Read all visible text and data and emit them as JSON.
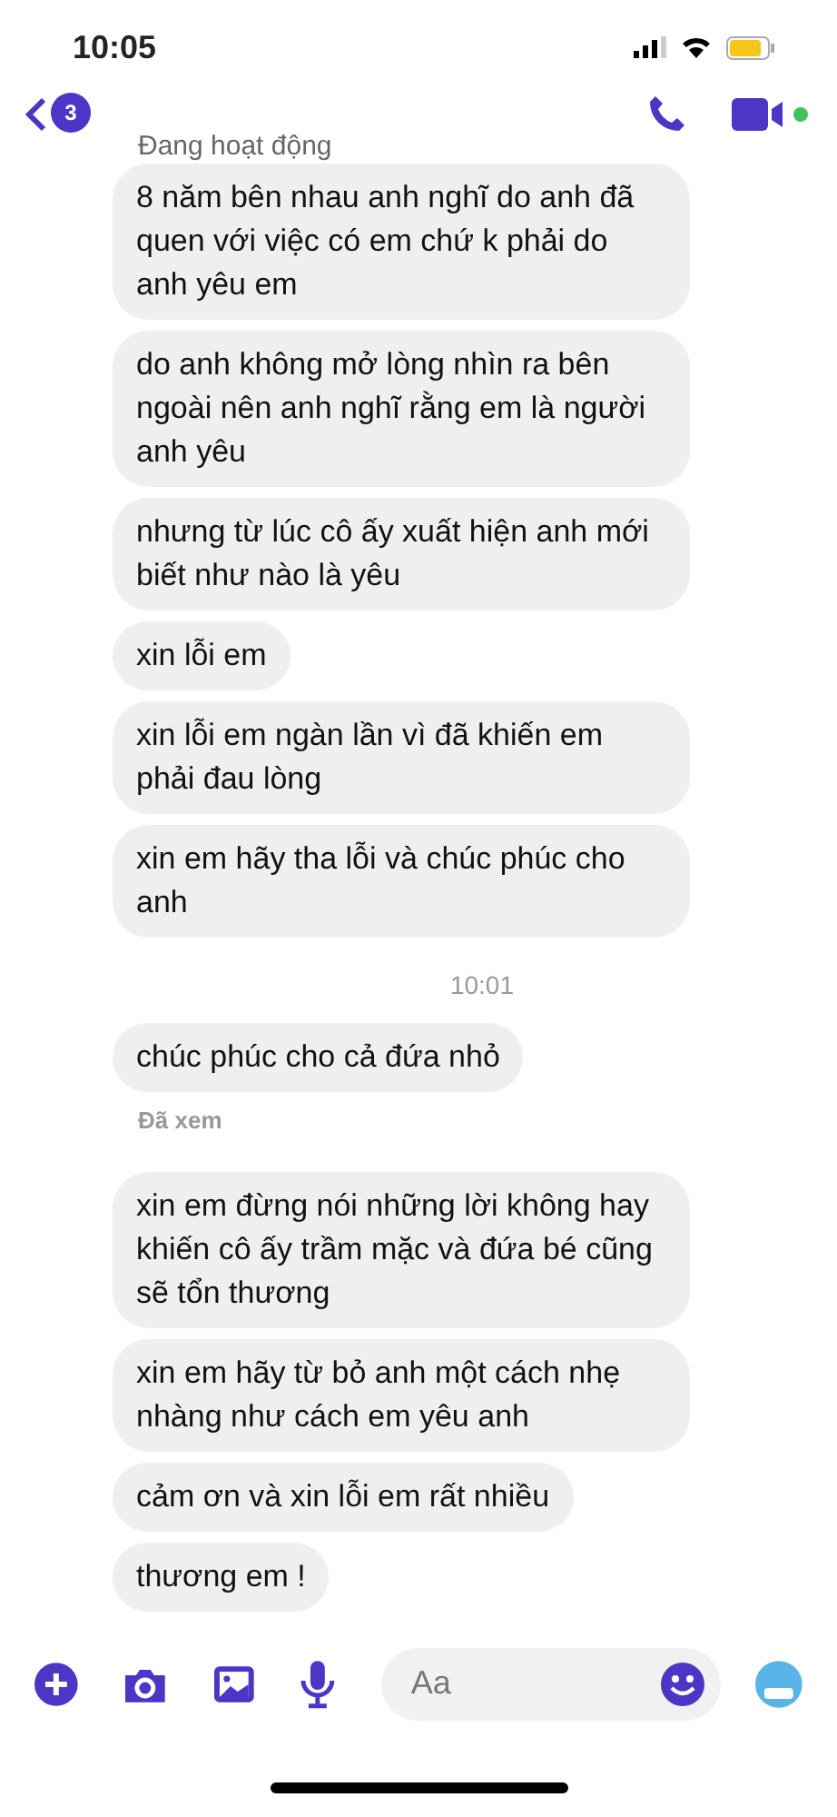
{
  "status_bar": {
    "time": "10:05"
  },
  "header": {
    "back_badge": "3",
    "status": "Đang hoạt động"
  },
  "messages": [
    {
      "kind": "bubble",
      "text": "8 năm bên nhau anh nghĩ do anh đã quen với việc có em chứ k phải do anh yêu em"
    },
    {
      "kind": "bubble",
      "text": "do anh không mở lòng nhìn ra bên ngoài nên anh nghĩ rằng em là người anh yêu"
    },
    {
      "kind": "bubble",
      "text": "nhưng từ lúc cô ấy xuất hiện anh mới biết như nào là yêu"
    },
    {
      "kind": "bubble",
      "text": "xin lỗi em"
    },
    {
      "kind": "bubble",
      "text": "xin lỗi em ngàn lần vì đã khiến em phải đau lòng"
    },
    {
      "kind": "bubble",
      "text": "xin em hãy tha lỗi và chúc phúc cho anh"
    },
    {
      "kind": "time",
      "text": "10:01"
    },
    {
      "kind": "bubble",
      "text": "chúc phúc cho cả đứa nhỏ"
    },
    {
      "kind": "seen",
      "text": "Đã xem"
    },
    {
      "kind": "bubble",
      "text": "xin em đừng nói những lời không hay khiến cô ấy trầm mặc và đứa bé cũng sẽ tổn thương"
    },
    {
      "kind": "bubble",
      "text": "xin em hãy từ bỏ anh một cách nhẹ nhàng như cách em yêu anh"
    },
    {
      "kind": "bubble",
      "text": "cảm ơn và xin lỗi em rất nhiều"
    },
    {
      "kind": "bubble",
      "text": "thương em !"
    }
  ],
  "composer": {
    "placeholder": "Aa"
  }
}
